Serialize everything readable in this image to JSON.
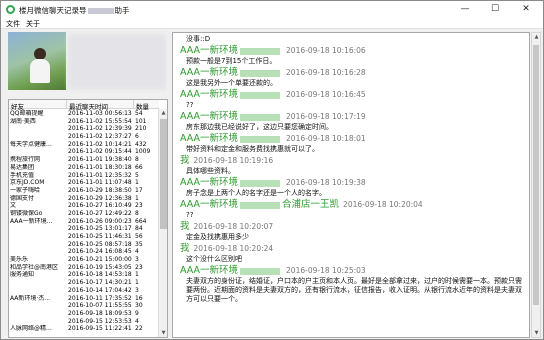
{
  "window": {
    "title_pre": "楼月微信聊天记录导",
    "title_post": "助手",
    "minimize": "—",
    "maximize": "☐",
    "close": "✕"
  },
  "menu": {
    "file": "文件",
    "about": "关于"
  },
  "table": {
    "headers": [
      "好友",
      "最近聊天时间",
      "数量"
    ],
    "rows": [
      [
        "QQ邮箱提醒",
        "2016-11-03 00:56:13",
        "54"
      ],
      [
        "湖南·美西",
        "2016-11-02 15:55:54",
        "101"
      ],
      [
        "",
        "2016-11-02 12:39:39",
        "210"
      ],
      [
        "",
        "2016-11-02 12:37:27",
        "6"
      ],
      [
        "每天学点健康...",
        "2016-11-02 10:14:21",
        "432"
      ],
      [
        "",
        "2016-11-02 09:15:44",
        "1009"
      ],
      [
        "携程旅行网",
        "2016-11-01 19:38:40",
        "8"
      ],
      [
        "易达集团",
        "2016-11-01 18:30:18",
        "66"
      ],
      [
        "手机充值",
        "2016-11-01 12:35:32",
        "5"
      ],
      [
        "京东JD.COM",
        "2016-11-01 11:07:48",
        "1"
      ],
      [
        "一家子嗨哈",
        "2016-10-29 18:38:50",
        "17"
      ],
      [
        "德国支付",
        "2016-10-29 12:36:38",
        "1"
      ],
      [
        "文",
        "2016-10-27 16:10:49",
        "23"
      ],
      [
        "钢镂微保Go",
        "2016-10-27 12:49:22",
        "8"
      ],
      [
        "AAA一新环境...",
        "2016-10-26 09:00:23",
        "664"
      ],
      [
        "",
        "2016-10-25 13:01:17",
        "84"
      ],
      [
        "",
        "2016-10-25 11:46:31",
        "56"
      ],
      [
        "",
        "2016-10-25 08:57:18",
        "35"
      ],
      [
        "",
        "2016-10-24 16:08:45",
        "4"
      ],
      [
        "美乐乐",
        "2016-10-21 15:00:00",
        "3"
      ],
      [
        "和品学社@南港区",
        "2016-10-19 15:43:05",
        "23"
      ],
      [
        "服务通知",
        "2016-10-18 14:53:18",
        "1"
      ],
      [
        "",
        "2016-10-17 14:30:21",
        "1"
      ],
      [
        "",
        "2016-10-14 17:04:42",
        "3"
      ],
      [
        "AA新环境·杰...",
        "2016-10-11 17:35:52",
        "16"
      ],
      [
        "",
        "2016-10-07 11:55:55",
        "30"
      ],
      [
        "",
        "2016-09-18 18:09:53",
        "9"
      ],
      [
        "",
        "2016-09-15 12:53:53",
        "4"
      ],
      [
        "人脉网络@精...",
        "2016-09-15 11:22:41",
        "22"
      ]
    ]
  },
  "chat": {
    "messages": [
      {
        "type": "text",
        "text": "没事::D"
      },
      {
        "type": "header",
        "sender": "AAA一新环境",
        "sender_suffix": "",
        "time": "2016-09-18 10:16:06"
      },
      {
        "type": "text",
        "text": "预款一般是7到15个工作日。"
      },
      {
        "type": "header",
        "sender": "AAA一新环境",
        "sender_suffix": "",
        "time": "2016-09-18 10:16:28"
      },
      {
        "type": "text",
        "text": "这是我另外一个单要还款的。"
      },
      {
        "type": "header",
        "sender": "AAA一新环境",
        "sender_suffix": "",
        "time": "2016-09-18 10:16:45"
      },
      {
        "type": "text",
        "text": "??"
      },
      {
        "type": "header",
        "sender": "AAA一新环境",
        "sender_suffix": "",
        "time": "2016-09-18 10:17:19"
      },
      {
        "type": "text",
        "text": "房东那边我已经说好了，这边只要您确定时间。"
      },
      {
        "type": "header",
        "sender": "AAA一新环境",
        "sender_suffix": "",
        "time": "2016-09-18 10:18:01"
      },
      {
        "type": "text",
        "text": "带好资料和定金和服务费找携惠就可以了。"
      },
      {
        "type": "header",
        "sender": "我",
        "sender_suffix": "",
        "time": "2016-09-18 10:19:16"
      },
      {
        "type": "text",
        "text": "具体哪些资料。"
      },
      {
        "type": "header",
        "sender": "AAA一新环境",
        "sender_suffix": "",
        "time": "2016-09-18 10:19:38"
      },
      {
        "type": "text",
        "text": "房子念是上两个人的名字还是一个人的名字。"
      },
      {
        "type": "header",
        "sender": "AAA一新环境",
        "sender_suffix": "合浦店一王凯",
        "time": "2016-09-18 10:20:04"
      },
      {
        "type": "text",
        "text": "??"
      },
      {
        "type": "header",
        "sender": "我",
        "sender_suffix": "",
        "time": "2016-09-18 10:20:07"
      },
      {
        "type": "text",
        "text": "定金及找携惠用多少"
      },
      {
        "type": "header",
        "sender": "我",
        "sender_suffix": "",
        "time": "2016-09-18 10:20:24"
      },
      {
        "type": "text",
        "text": "这个没什么区别吧"
      },
      {
        "type": "header",
        "sender": "AAA一新环境",
        "sender_suffix": "",
        "time": "2016-09-18 10:25:03"
      },
      {
        "type": "text",
        "text": "夫妻双方的身份证，结婚证，户口本的户主页和本人页。最好是全部拿过来，过户的时候需要一本。预款只需要两份。近期面的资料是夫妻双方的，还有银行流水，征信报告，收入证明。从银行流水近年的资料是夫妻双方可以只要一个。"
      }
    ]
  }
}
